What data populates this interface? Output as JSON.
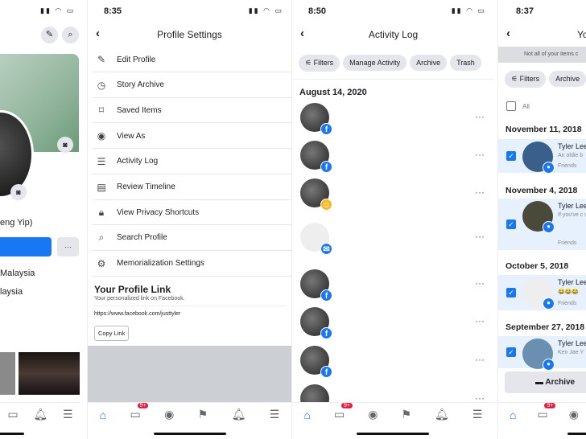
{
  "panel1": {
    "name_fragment": "eng Yip)",
    "location1": "Malaysia",
    "location2": "laysia",
    "more_label": "···"
  },
  "panel2": {
    "time": "8:35",
    "title": "Profile Settings",
    "items": [
      {
        "label": "Edit Profile",
        "icon": "pencil-icon"
      },
      {
        "label": "Story Archive",
        "icon": "clock-icon"
      },
      {
        "label": "Saved Items",
        "icon": "bookmark-icon"
      },
      {
        "label": "View As",
        "icon": "eye-icon"
      },
      {
        "label": "Activity Log",
        "icon": "list-icon"
      },
      {
        "label": "Review Timeline",
        "icon": "timeline-icon"
      },
      {
        "label": "View Privacy Shortcuts",
        "icon": "lock-icon"
      },
      {
        "label": "Search Profile",
        "icon": "search-icon"
      },
      {
        "label": "Memorialization Settings",
        "icon": "gear-user-icon"
      }
    ],
    "link_title": "Your Profile Link",
    "link_subtitle": "Your personalized link on Facebook.",
    "link_url": "https://www.facebook.com/justtyler",
    "copy_label": "Copy Link",
    "badge": "9+"
  },
  "panel3": {
    "time": "8:50",
    "title": "Activity Log",
    "chips": [
      "Filters",
      "Manage Activity",
      "Archive",
      "Trash"
    ],
    "date": "August 14, 2020",
    "dots": "···",
    "badge": "9+"
  },
  "panel4": {
    "time": "8:37",
    "title_fragment": "Yo",
    "notice": "Not all of your items c",
    "chips": [
      "Filters",
      "Archive"
    ],
    "all_label": "All",
    "archive_button": "Archive",
    "badge": "9+",
    "entries": [
      {
        "date": "November 11, 2018",
        "name": "Tyler Lee",
        "text": "An oldie b",
        "audience": "Friends"
      },
      {
        "date": "November 4, 2018",
        "name": "Tyler Lee",
        "text": "If you've c would pay",
        "audience": "Friends"
      },
      {
        "date": "October 5, 2018",
        "name": "Tyler Lee",
        "text": "😂😂😂",
        "audience": "Friends"
      },
      {
        "date": "September 27, 2018",
        "name": "Tyler Lee",
        "text": "Ken Jae Y",
        "audience": ""
      }
    ]
  }
}
